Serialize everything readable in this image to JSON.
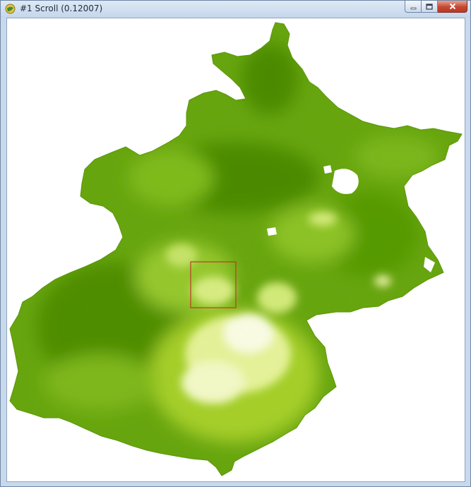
{
  "window": {
    "title": "#1 Scroll (0.12007)",
    "icon": "globe-icon"
  },
  "caption_buttons": {
    "minimize": "minimize-icon",
    "maximize": "maximize-icon",
    "close": "close-icon"
  },
  "map": {
    "layer": "beijing-vegetation-raster",
    "colors": {
      "dark_green": "#4c8a00",
      "mid_green": "#68a510",
      "light_green": "#a6cf2c",
      "pale_yellow": "#e6f29a",
      "urban_white": "#fbfde6",
      "zoom_box": "#c0392b"
    }
  }
}
